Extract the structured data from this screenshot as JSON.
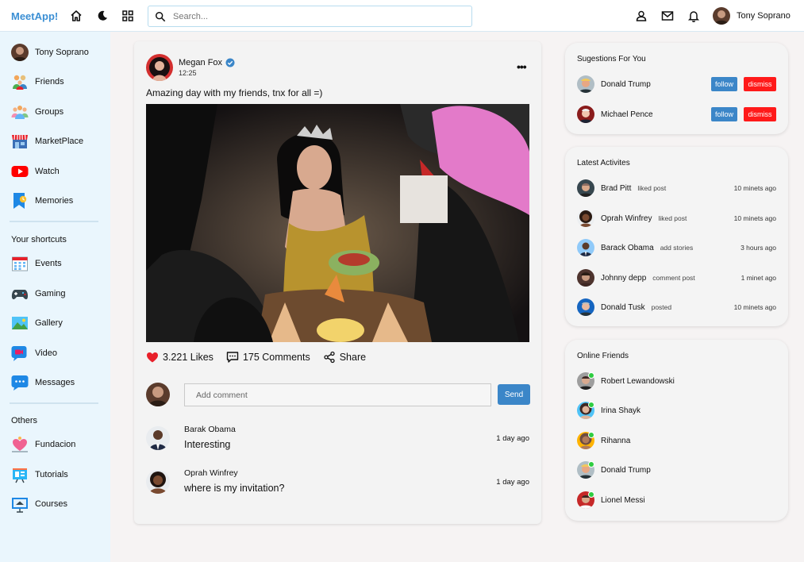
{
  "app": {
    "logo": "MeetApp!"
  },
  "topbar": {
    "search_placeholder": "Search...",
    "user_name": "Tony Soprano"
  },
  "sidebar": {
    "main_items": [
      {
        "label": "Tony Soprano",
        "icon": "avatar"
      },
      {
        "label": "Friends",
        "icon": "friends-icon"
      },
      {
        "label": "Groups",
        "icon": "groups-icon"
      },
      {
        "label": "MarketPlace",
        "icon": "marketplace-icon"
      },
      {
        "label": "Watch",
        "icon": "watch-icon"
      },
      {
        "label": "Memories",
        "icon": "memories-icon"
      }
    ],
    "shortcuts_heading": "Your shortcuts",
    "shortcuts": [
      {
        "label": "Events",
        "icon": "calendar-icon"
      },
      {
        "label": "Gaming",
        "icon": "gamepad-icon"
      },
      {
        "label": "Gallery",
        "icon": "gallery-icon"
      },
      {
        "label": "Video",
        "icon": "video-icon"
      },
      {
        "label": "Messages",
        "icon": "messages-icon"
      }
    ],
    "others_heading": "Others",
    "others": [
      {
        "label": "Fundacion",
        "icon": "fundraiser-icon"
      },
      {
        "label": "Tutorials",
        "icon": "tutorials-icon"
      },
      {
        "label": "Courses",
        "icon": "courses-icon"
      }
    ]
  },
  "post": {
    "author": "Megan Fox",
    "time": "12:25",
    "text": "Amazing day with my friends, tnx for all =)",
    "likes": "3.221 Likes",
    "comments": "175 Comments",
    "share": "Share",
    "comment_placeholder": "Add comment",
    "send_label": "Send",
    "comment_list": [
      {
        "name": "Barak Obama",
        "text": "Interesting",
        "date": "1 day ago"
      },
      {
        "name": "Oprah Winfrey",
        "text": "where is my invitation?",
        "date": "1 day ago"
      }
    ]
  },
  "suggestions": {
    "title": "Sugestions For You",
    "follow_label": "follow",
    "dismiss_label": "dismiss",
    "items": [
      {
        "name": "Donald Trump"
      },
      {
        "name": "Michael Pence"
      }
    ]
  },
  "activities": {
    "title": "Latest Activites",
    "items": [
      {
        "name": "Brad Pitt",
        "action": "liked post",
        "time": "10 minets ago"
      },
      {
        "name": "Oprah Winfrey",
        "action": "liked post",
        "time": "10 minets ago"
      },
      {
        "name": "Barack Obama",
        "action": "add stories",
        "time": "3 hours ago"
      },
      {
        "name": "Johnny depp",
        "action": "comment post",
        "time": "1 minet ago"
      },
      {
        "name": "Donald Tusk",
        "action": "posted",
        "time": "10 minets ago"
      }
    ]
  },
  "online": {
    "title": "Online Friends",
    "items": [
      {
        "name": "Robert Lewandowski"
      },
      {
        "name": "Irina Shayk"
      },
      {
        "name": "Rihanna"
      },
      {
        "name": "Donald Trump"
      },
      {
        "name": "Lionel Messi"
      }
    ]
  },
  "colors": {
    "accent": "#3b86c8",
    "logo": "#3b8fd4",
    "dismiss": "#ff1a1a",
    "sidebar_bg": "#eaf6fd",
    "online": "#2ecc40",
    "like": "#e8202a"
  }
}
